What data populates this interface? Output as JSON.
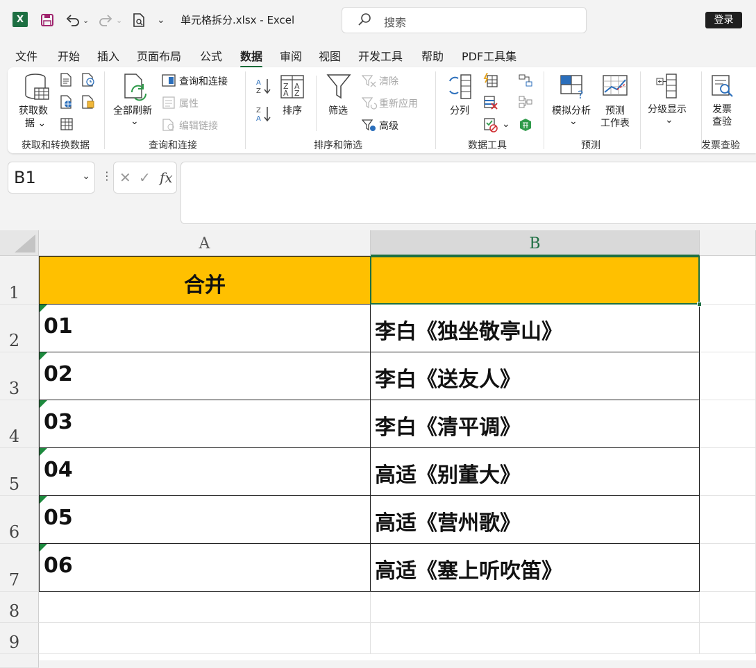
{
  "titlebar": {
    "app_icon": "X",
    "save_icon": "save-icon",
    "undo_icon": "undo-icon",
    "redo_icon": "redo-icon",
    "file_title": "单元格拆分.xlsx  -  Excel",
    "search_placeholder": "搜索",
    "login_label": "登录"
  },
  "menu": [
    "文件",
    "开始",
    "插入",
    "页面布局",
    "公式",
    "数据",
    "审阅",
    "视图",
    "开发工具",
    "帮助",
    "PDF工具集"
  ],
  "menu_active": "数据",
  "ribbon": {
    "get_data": "获取数",
    "get_data2": "据",
    "refresh_all": "全部刷新",
    "queries_connections": "查询和连接",
    "properties": "属性",
    "edit_links": "编辑链接",
    "sort": "排序",
    "filter": "筛选",
    "clear": "清除",
    "reapply": "重新应用",
    "advanced": "高级",
    "text_to_columns": "分列",
    "what_if": "模拟分析",
    "forecast_sheet1": "预测",
    "forecast_sheet2": "工作表",
    "outline": "分级显示",
    "invoice1": "发票",
    "invoice2": "查验",
    "groups": {
      "get_transform": "获取和转换数据",
      "queries": "查询和连接",
      "sort_filter": "排序和筛选",
      "data_tools": "数据工具",
      "forecast": "预测",
      "invoice": "发票查验"
    }
  },
  "namebox": "B1",
  "formula_value": "",
  "columns": [
    "A",
    "B"
  ],
  "rows": [
    "1",
    "2",
    "3",
    "4",
    "5",
    "6",
    "7",
    "8",
    "9"
  ],
  "cells": {
    "a1": "合并",
    "b1": "",
    "data": [
      {
        "a": "01",
        "b": "李白《独坐敬亭山》"
      },
      {
        "a": "02",
        "b": "李白《送友人》"
      },
      {
        "a": "03",
        "b": "李白《清平调》"
      },
      {
        "a": "04",
        "b": "高适《别董大》"
      },
      {
        "a": "05",
        "b": "高适《营州歌》"
      },
      {
        "a": "06",
        "b": "高适《塞上听吹笛》"
      }
    ]
  },
  "colors": {
    "header_fill": "#ffc000",
    "accent": "#1d6f42"
  }
}
